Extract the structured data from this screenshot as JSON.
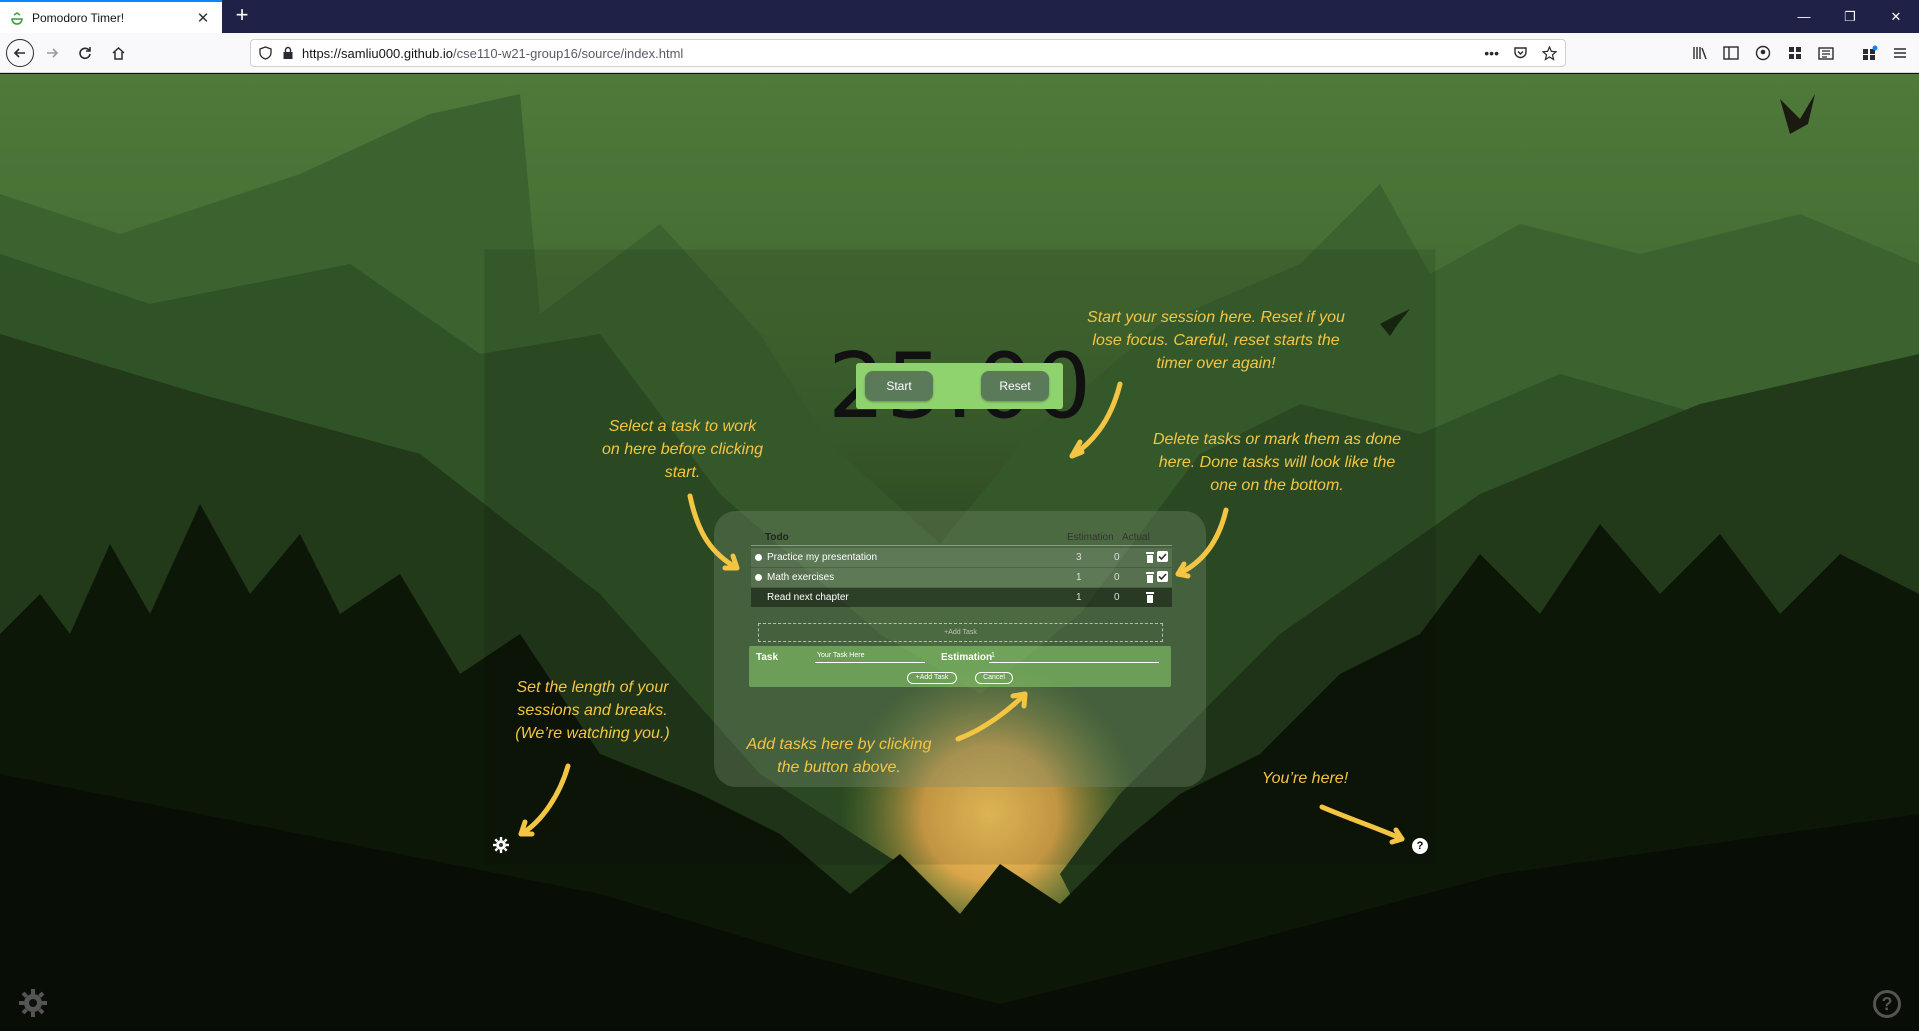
{
  "browser": {
    "tab_title": "Pomodoro Timer!",
    "url_host": "https://samliu000.github.io",
    "url_path": "/cse110-w21-group16/source/index.html",
    "url_more": "•••"
  },
  "app": {
    "timer": "25:00",
    "start_label": "Start",
    "reset_label": "Reset",
    "table_headers": {
      "todo": "Todo",
      "estimation": "Estimation",
      "actual": "Actual"
    },
    "tasks": [
      {
        "name": "Practice my presentation",
        "estimation": "3",
        "actual": "0",
        "done": false
      },
      {
        "name": "Math exercises",
        "estimation": "1",
        "actual": "0",
        "done": false
      },
      {
        "name": "Read next chapter",
        "estimation": "1",
        "actual": "0",
        "done": true
      }
    ],
    "add_task_dashed": "+Add Task",
    "form": {
      "task_label": "Task",
      "task_value": "Your Task Here",
      "estimation_label": "Estimation",
      "estimation_value": "1",
      "add_button": "+Add Task",
      "cancel_button": "Cancel"
    },
    "help_symbol": "?"
  },
  "annotations": {
    "start": "Start your session here. Reset if you lose focus. Careful, reset starts the timer over again!",
    "select": "Select a task to work on here before clicking start.",
    "delete": "Delete tasks or mark them as done here. Done tasks will look like the one on the bottom.",
    "settings": "Set the length of your sessions and breaks. (We’re watching you.)",
    "add": "Add tasks here by clicking the button above.",
    "here": "You’re here!"
  },
  "colors": {
    "annotation": "#f4c542",
    "button_bar": "#8fd36f",
    "button": "#5b7a5a"
  }
}
